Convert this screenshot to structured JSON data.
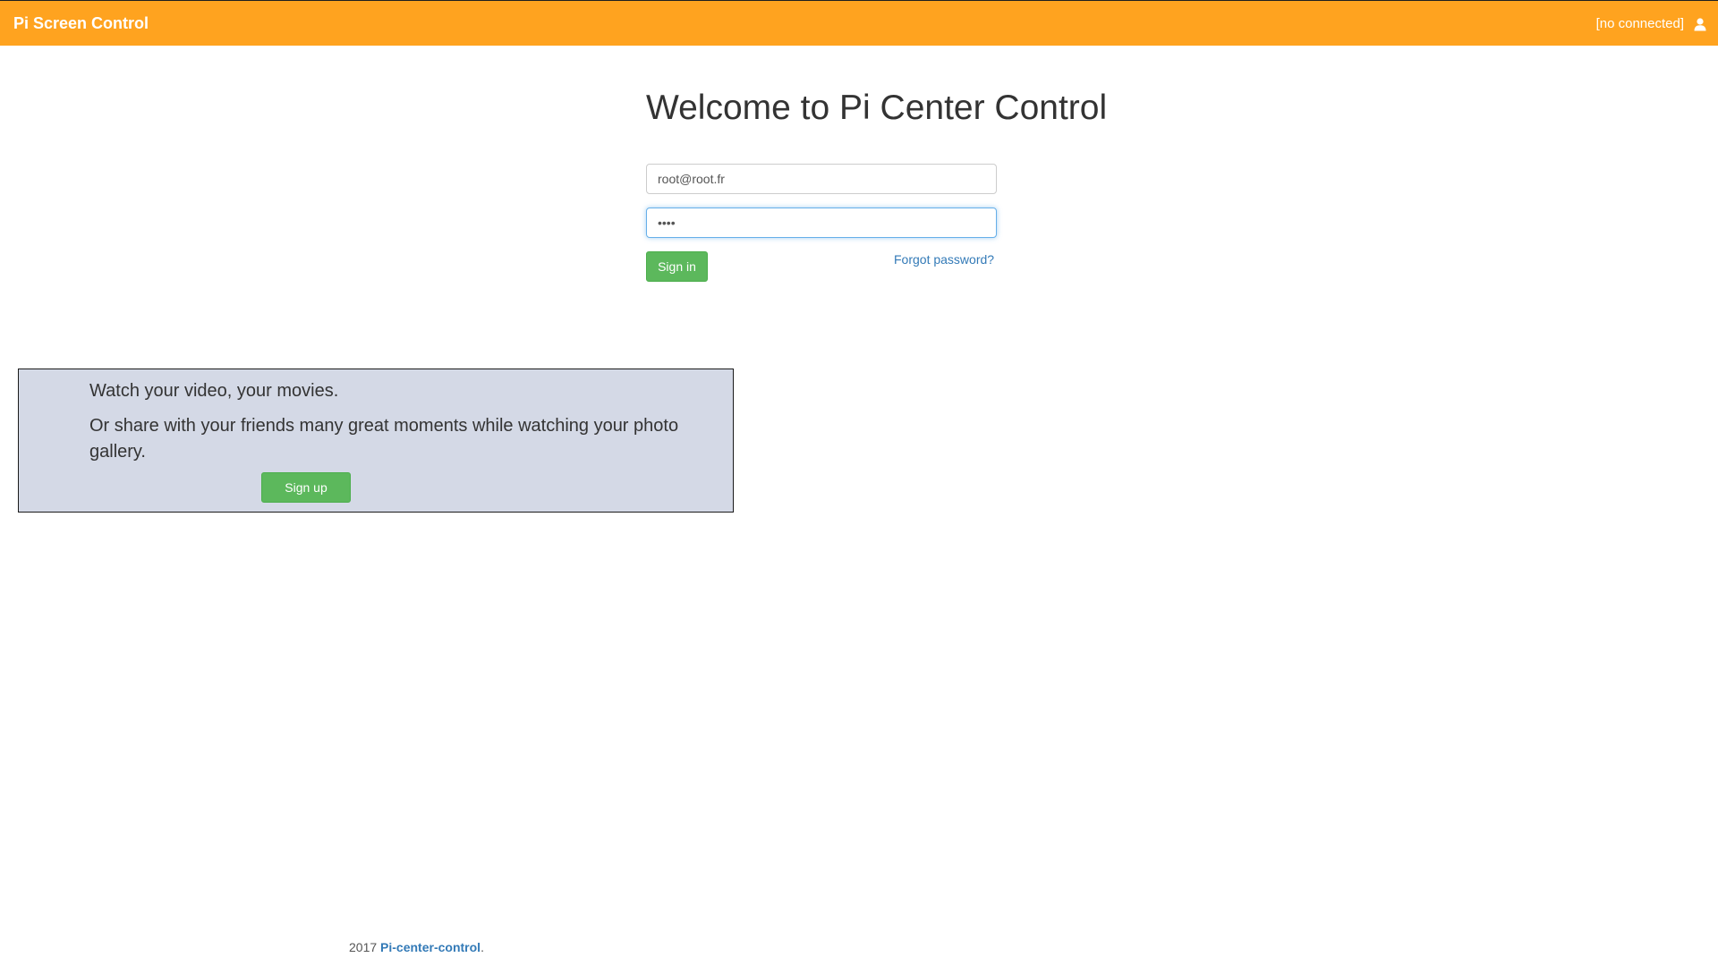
{
  "navbar": {
    "brand": "Pi Screen Control",
    "status": "[no connected]",
    "user_icon": "user-icon",
    "background_color": "#ffa31f"
  },
  "login": {
    "title": "Welcome to Pi Center Control",
    "email_value": "root@root.fr",
    "password_value": "••••",
    "signin_label": "Sign in",
    "forgot_label": "Forgot password?"
  },
  "promo": {
    "line1": "Watch your video, your movies.",
    "line2": "Or share with your friends many great moments while watching your photo gallery.",
    "signup_label": "Sign up",
    "background_color": "#d4d9e6"
  },
  "footer": {
    "year": "2017",
    "link_text": "Pi-center-control",
    "suffix": "."
  },
  "colors": {
    "button_green": "#5cb85c",
    "link_blue": "#337ab7"
  }
}
